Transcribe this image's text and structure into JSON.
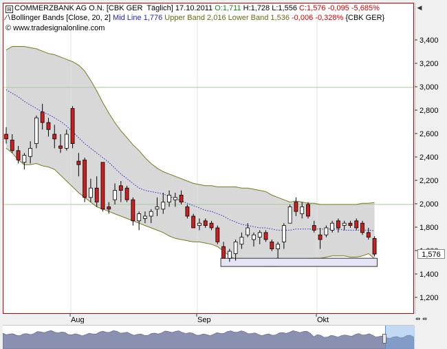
{
  "header": {
    "symbol": "COMMERZBANK AG O.N.",
    "meta": "[CBK GER  Täglich]",
    "date": "17.10.2011",
    "ohlc": {
      "o_label": "O:",
      "o_value": "1,711",
      "h_label": "H:",
      "h_value": "1,728",
      "l_label": "L:",
      "l_value": "1,556",
      "c_label": "C:",
      "c_value": "1,576",
      "change": "-0,095",
      "change_pct": "-5,685%"
    },
    "indicator_name": "Bollinger Bands [Close, 20, 2]",
    "mid_label": "Mid Line",
    "mid_value": "1,776",
    "upper_label": "Upper Band",
    "upper_value": "2,016",
    "lower_label": "Lower Band",
    "lower_value": "1,536",
    "lower_change": "-0,006",
    "lower_change_pct": "-0,328%",
    "lower_symbol": "{CBK GER}",
    "copyright": "© www.tradesignalonline.com"
  },
  "colors": {
    "up_candle": "#ffffff",
    "down_candle": "#cc1f1f",
    "band_fill": "#d8d8d8",
    "band_line": "#7a7a1a",
    "mid_line": "#2222cc",
    "grid_hline": "#a8c8a0",
    "plot_border": "#c00000",
    "positive": "#118811",
    "negative": "#cc0000"
  },
  "price_tag": "1,576",
  "chart_data": {
    "type": "candlestick",
    "ylim": [
      1.05,
      3.6
    ],
    "yticks": [
      "1,200",
      "1,400",
      "1,600",
      "1,800",
      "2,000",
      "2,200",
      "2,400",
      "2,600",
      "2,800",
      "3,000",
      "3,200",
      "3,400"
    ],
    "xticks": [
      "Aug",
      "Sep",
      "Okt"
    ],
    "hlines": [
      3.0,
      2.0
    ],
    "series": [
      {
        "name": "Bollinger Bands [Close, 20, 2]",
        "kind": "candles",
        "ohlc": [
          [
            2.6,
            2.66,
            2.52,
            2.56
          ],
          [
            2.55,
            2.6,
            2.44,
            2.46
          ],
          [
            2.46,
            2.5,
            2.35,
            2.38
          ],
          [
            2.36,
            2.44,
            2.3,
            2.42
          ],
          [
            2.41,
            2.54,
            2.35,
            2.48
          ],
          [
            2.52,
            2.76,
            2.48,
            2.74
          ],
          [
            2.79,
            2.86,
            2.64,
            2.7
          ],
          [
            2.7,
            2.74,
            2.58,
            2.64
          ],
          [
            2.6,
            2.68,
            2.48,
            2.56
          ],
          [
            2.5,
            2.6,
            2.44,
            2.48
          ],
          [
            2.48,
            2.64,
            2.46,
            2.6
          ],
          [
            2.82,
            2.84,
            2.48,
            2.52
          ],
          [
            2.37,
            2.44,
            2.24,
            2.34
          ],
          [
            2.38,
            2.4,
            2.02,
            2.06
          ],
          [
            2.06,
            2.22,
            2.02,
            2.14
          ],
          [
            2.14,
            2.24,
            1.98,
            2.02
          ],
          [
            2.36,
            2.36,
            1.94,
            1.96
          ],
          [
            1.98,
            2.02,
            1.92,
            1.96
          ],
          [
            2.04,
            2.18,
            2.0,
            2.12
          ],
          [
            2.16,
            2.2,
            2.02,
            2.12
          ],
          [
            2.14,
            2.16,
            2.02,
            2.04
          ],
          [
            2.04,
            2.06,
            1.82,
            1.86
          ],
          [
            1.86,
            1.94,
            1.78,
            1.92
          ],
          [
            1.88,
            1.94,
            1.84,
            1.9
          ],
          [
            1.9,
            1.96,
            1.84,
            1.94
          ],
          [
            1.96,
            2.06,
            1.9,
            1.98
          ],
          [
            1.96,
            2.1,
            1.92,
            2.02
          ],
          [
            2.02,
            2.12,
            1.98,
            2.08
          ],
          [
            2.04,
            2.1,
            1.98,
            2.06
          ],
          [
            2.08,
            2.12,
            2.0,
            2.02
          ],
          [
            1.98,
            2.0,
            1.88,
            1.9
          ],
          [
            1.9,
            1.92,
            1.8,
            1.8
          ],
          [
            1.82,
            1.88,
            1.78,
            1.84
          ],
          [
            1.86,
            1.88,
            1.8,
            1.82
          ],
          [
            1.84,
            1.86,
            1.78,
            1.8
          ],
          [
            1.8,
            1.82,
            1.66,
            1.68
          ],
          [
            1.64,
            1.68,
            1.54,
            1.54
          ],
          [
            1.54,
            1.62,
            1.51,
            1.6
          ],
          [
            1.58,
            1.7,
            1.52,
            1.68
          ],
          [
            1.66,
            1.76,
            1.62,
            1.72
          ],
          [
            1.74,
            1.84,
            1.72,
            1.8
          ],
          [
            1.7,
            1.76,
            1.64,
            1.74
          ],
          [
            1.72,
            1.78,
            1.66,
            1.76
          ],
          [
            1.76,
            1.78,
            1.68,
            1.7
          ],
          [
            1.68,
            1.7,
            1.6,
            1.62
          ],
          [
            1.62,
            1.68,
            1.54,
            1.66
          ],
          [
            1.68,
            1.84,
            1.62,
            1.82
          ],
          [
            1.84,
            2.0,
            1.84,
            1.98
          ],
          [
            2.02,
            2.06,
            1.9,
            1.94
          ],
          [
            1.92,
            2.02,
            1.88,
            1.98
          ],
          [
            2.0,
            2.02,
            1.88,
            1.9
          ],
          [
            1.82,
            1.86,
            1.76,
            1.78
          ],
          [
            1.74,
            1.8,
            1.62,
            1.7
          ],
          [
            1.74,
            1.82,
            1.72,
            1.8
          ],
          [
            1.78,
            1.86,
            1.76,
            1.84
          ],
          [
            1.86,
            1.88,
            1.76,
            1.8
          ],
          [
            1.82,
            1.86,
            1.78,
            1.84
          ],
          [
            1.84,
            1.86,
            1.8,
            1.82
          ],
          [
            1.86,
            1.88,
            1.78,
            1.8
          ],
          [
            1.84,
            1.86,
            1.74,
            1.76
          ],
          [
            1.76,
            1.8,
            1.7,
            1.72
          ],
          [
            1.71,
            1.728,
            1.556,
            1.576
          ]
        ]
      },
      {
        "name": "Upper Band",
        "kind": "line",
        "values": [
          3.32,
          3.35,
          3.35,
          3.35,
          3.34,
          3.33,
          3.31,
          3.29,
          3.28,
          3.26,
          3.24,
          3.22,
          3.19,
          3.14,
          3.06,
          2.97,
          2.87,
          2.78,
          2.7,
          2.63,
          2.57,
          2.51,
          2.46,
          2.4,
          2.35,
          2.31,
          2.28,
          2.26,
          2.24,
          2.22,
          2.2,
          2.18,
          2.17,
          2.16,
          2.16,
          2.15,
          2.15,
          2.15,
          2.15,
          2.14,
          2.14,
          2.13,
          2.12,
          2.11,
          2.08,
          2.06,
          2.04,
          2.02,
          2.03,
          2.02,
          2.01,
          2.01,
          2.0,
          2.0,
          2.0,
          2.0,
          2.0,
          2.0,
          2.0,
          2.01,
          2.01,
          2.016
        ]
      },
      {
        "name": "Lower Band",
        "kind": "line",
        "values": [
          2.48,
          2.44,
          2.38,
          2.34,
          2.34,
          2.35,
          2.33,
          2.32,
          2.3,
          2.25,
          2.2,
          2.15,
          2.1,
          2.06,
          2.02,
          1.98,
          1.96,
          1.94,
          1.92,
          1.9,
          1.88,
          1.86,
          1.84,
          1.82,
          1.8,
          1.78,
          1.76,
          1.73,
          1.71,
          1.7,
          1.69,
          1.68,
          1.68,
          1.67,
          1.66,
          1.64,
          1.6,
          1.56,
          1.53,
          1.51,
          1.5,
          1.49,
          1.48,
          1.47,
          1.47,
          1.47,
          1.48,
          1.5,
          1.52,
          1.53,
          1.53,
          1.54,
          1.54,
          1.55,
          1.56,
          1.56,
          1.56,
          1.55,
          1.55,
          1.56,
          1.58,
          1.536
        ]
      },
      {
        "name": "Mid Line",
        "kind": "line",
        "values": [
          2.98,
          2.95,
          2.92,
          2.88,
          2.85,
          2.82,
          2.79,
          2.77,
          2.74,
          2.71,
          2.67,
          2.62,
          2.57,
          2.52,
          2.48,
          2.44,
          2.4,
          2.36,
          2.31,
          2.26,
          2.22,
          2.18,
          2.14,
          2.12,
          2.11,
          2.1,
          2.09,
          2.07,
          2.05,
          2.03,
          2.01,
          1.99,
          1.97,
          1.95,
          1.94,
          1.92,
          1.9,
          1.87,
          1.85,
          1.83,
          1.82,
          1.81,
          1.8,
          1.8,
          1.79,
          1.78,
          1.78,
          1.78,
          1.79,
          1.79,
          1.79,
          1.79,
          1.79,
          1.79,
          1.79,
          1.79,
          1.78,
          1.78,
          1.78,
          1.78,
          1.78,
          1.776
        ]
      }
    ],
    "highlight_range": {
      "x_from": 36,
      "x_to": 61,
      "y_from": 1.47,
      "y_to": 1.54
    }
  }
}
